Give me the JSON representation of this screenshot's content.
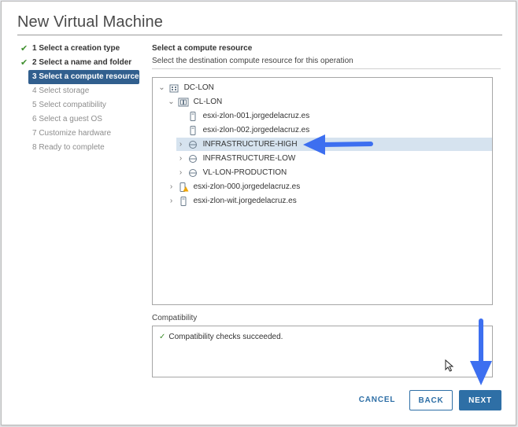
{
  "window": {
    "title": "New Virtual Machine"
  },
  "steps": [
    {
      "label": "1 Select a creation type",
      "state": "done"
    },
    {
      "label": "2 Select a name and folder",
      "state": "done"
    },
    {
      "label": "3 Select a compute resource",
      "state": "active"
    },
    {
      "label": "4 Select storage",
      "state": "pending"
    },
    {
      "label": "5 Select compatibility",
      "state": "pending"
    },
    {
      "label": "6 Select a guest OS",
      "state": "pending"
    },
    {
      "label": "7 Customize hardware",
      "state": "pending"
    },
    {
      "label": "8 Ready to complete",
      "state": "pending"
    }
  ],
  "main": {
    "title": "Select a compute resource",
    "subtitle": "Select the destination compute resource for this operation"
  },
  "tree": [
    {
      "label": "DC-LON",
      "icon": "datacenter-icon",
      "expand": "expanded"
    },
    {
      "label": "CL-LON",
      "icon": "cluster-icon",
      "expand": "expanded"
    },
    {
      "label": "esxi-zlon-001.jorgedelacruz.es",
      "icon": "host-icon",
      "expand": "none"
    },
    {
      "label": "esxi-zlon-002.jorgedelacruz.es",
      "icon": "host-icon",
      "expand": "none"
    },
    {
      "label": "INFRASTRUCTURE-HIGH",
      "icon": "resource-pool-icon",
      "expand": "collapsed",
      "selected": true
    },
    {
      "label": "INFRASTRUCTURE-LOW",
      "icon": "resource-pool-icon",
      "expand": "collapsed"
    },
    {
      "label": "VL-LON-PRODUCTION",
      "icon": "resource-pool-icon",
      "expand": "collapsed"
    },
    {
      "label": "esxi-zlon-000.jorgedelacruz.es",
      "icon": "host-warning-icon",
      "expand": "collapsed"
    },
    {
      "label": "esxi-zlon-wit.jorgedelacruz.es",
      "icon": "host-icon",
      "expand": "collapsed"
    }
  ],
  "compatibility": {
    "label": "Compatibility",
    "message": "Compatibility checks succeeded."
  },
  "buttons": {
    "cancel": "CANCEL",
    "back": "BACK",
    "next": "NEXT"
  },
  "colors": {
    "accent": "#2e6fa6",
    "active_step": "#315f8e",
    "success": "#3f8f2e",
    "selection": "#d6e3ef",
    "annotation_arrow": "#3d6ff0",
    "warning": "#f0a500"
  }
}
